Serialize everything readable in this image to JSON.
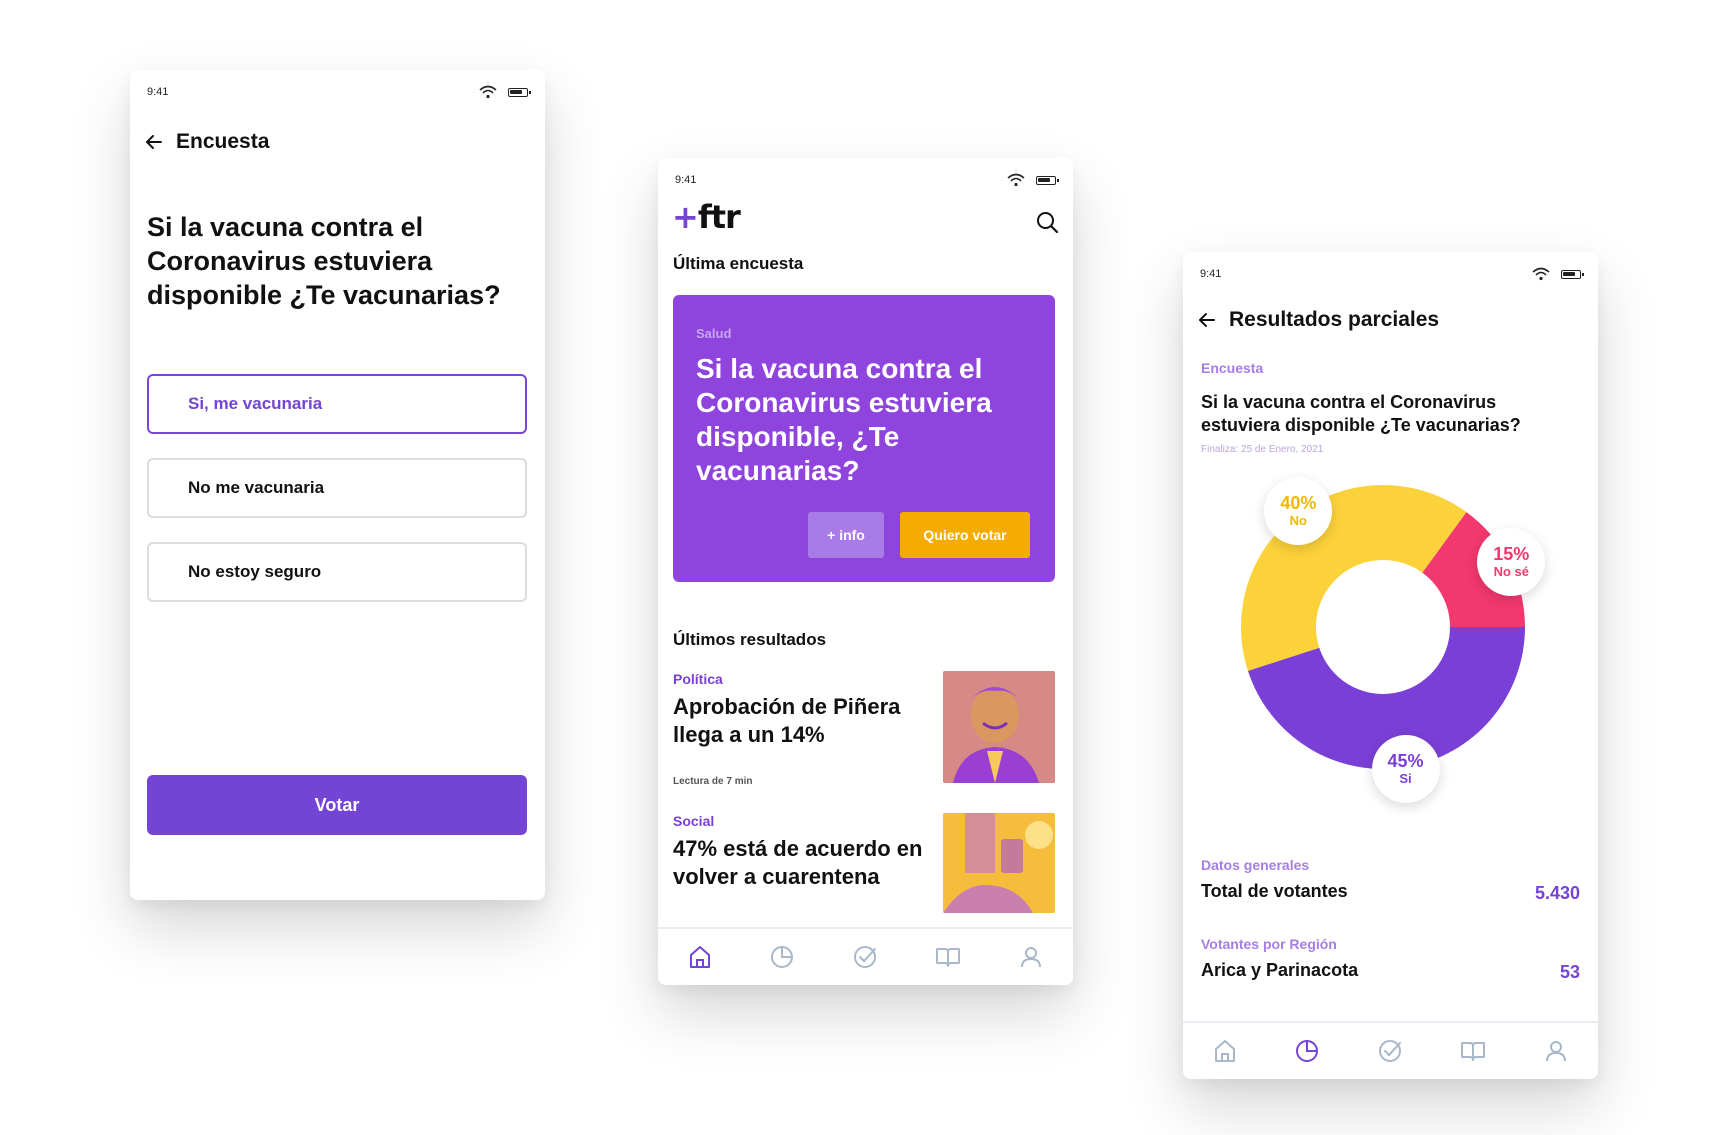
{
  "colors": {
    "purple": "#7444D4",
    "card_purple": "#8E44DD",
    "yellow": "#FCD23A",
    "orange_button": "#F5AC00",
    "pink": "#F2386E",
    "light_purple_label": "#A67EE3"
  },
  "status_bar": {
    "time": "9:41",
    "icons": [
      "wifi-icon",
      "battery-icon"
    ]
  },
  "survey_screen": {
    "title": "Encuesta",
    "question": "Si la vacuna contra el Coronavirus estuviera disponible ¿Te vacunarias?",
    "options": [
      "Si, me vacunaria",
      "No me vacunaria",
      "No estoy seguro"
    ],
    "selected_option": "Si, me vacunaria",
    "vote_button": "Votar"
  },
  "home_screen": {
    "logo_plus": "+",
    "logo_text": "ftr",
    "latest_poll_heading": "Última encuesta",
    "poll_card": {
      "category": "Salud",
      "question": "Si la vacuna contra el Coronavirus estuviera disponible, ¿Te vacunarias?",
      "info_button": "+ info",
      "vote_button": "Quiero votar"
    },
    "latest_results_heading": "Últimos resultados",
    "news": [
      {
        "category": "Política",
        "title": "Aprobación de Piñera llega a un 14%",
        "meta": "Lectura de 7 min"
      },
      {
        "category": "Social",
        "title": "47% está de acuerdo en volver a cuarentena",
        "meta": ""
      }
    ],
    "tabs": [
      "home-icon",
      "chart-pie-icon",
      "check-circle-icon",
      "book-icon",
      "user-icon"
    ],
    "active_tab": "home-icon"
  },
  "results_screen": {
    "title": "Resultados parciales",
    "survey_label": "Encuesta",
    "question": "Si la vacuna contra el Coronavirus estuviera disponible ¿Te vacunarias?",
    "ends": "Finaliza: 25 de Enero, 2021",
    "general_label": "Datos generales",
    "total_label": "Total de votantes",
    "total_value": "5.430",
    "region_label": "Votantes por Región",
    "region_name": "Arica y Parinacota",
    "region_value": "53",
    "active_tab": "chart-pie-icon"
  },
  "chart_data": {
    "type": "pie",
    "categories": [
      "Si",
      "No",
      "No sé"
    ],
    "values": [
      45,
      40,
      15
    ],
    "labels": [
      "45%",
      "40%",
      "15%"
    ],
    "colors": [
      "#7A3FD6",
      "#FCD23A",
      "#F2386E"
    ]
  }
}
